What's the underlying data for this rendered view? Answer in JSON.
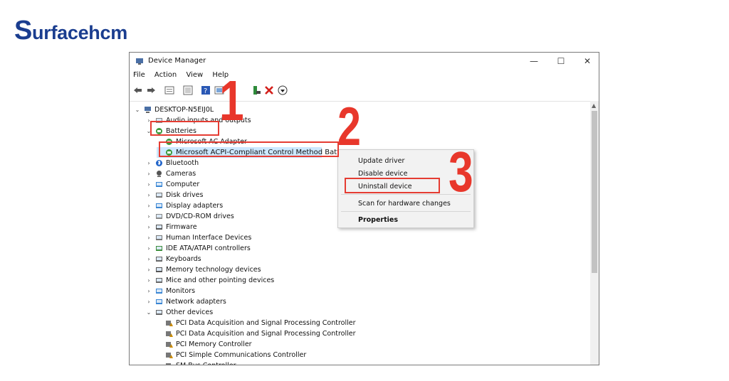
{
  "logo": {
    "first": "S",
    "rest": "urfacehcm"
  },
  "window": {
    "title": "Device Manager",
    "minimize": "—",
    "maximize": "☐",
    "close": "✕"
  },
  "menu": [
    "File",
    "Action",
    "View",
    "Help"
  ],
  "toolbar_icons": [
    "back-icon",
    "forward-icon",
    "properties-icon",
    "update-icon",
    "help-icon",
    "scan-icon",
    "add-driver-icon",
    "remove-icon",
    "disable-icon"
  ],
  "tree": {
    "root": "DESKTOP-N5EIJ0L",
    "items": [
      {
        "label": "Audio inputs and outputs",
        "icon": "speaker-icon"
      },
      {
        "label": "Batteries",
        "icon": "battery-icon",
        "expanded": true
      },
      {
        "label": "Microsoft AC Adapter",
        "icon": "battery-icon"
      },
      {
        "label": "Microsoft ACPI-Compliant Control Method Battery",
        "icon": "battery-icon"
      },
      {
        "label": "Bluetooth",
        "icon": "bluetooth-icon"
      },
      {
        "label": "Cameras",
        "icon": "camera-icon"
      },
      {
        "label": "Computer",
        "icon": "monitor-icon"
      },
      {
        "label": "Disk drives",
        "icon": "disk-icon"
      },
      {
        "label": "Display adapters",
        "icon": "display-icon"
      },
      {
        "label": "DVD/CD-ROM drives",
        "icon": "dvd-icon"
      },
      {
        "label": "Firmware",
        "icon": "chip-icon"
      },
      {
        "label": "Human Interface Devices",
        "icon": "hid-icon"
      },
      {
        "label": "IDE ATA/ATAPI controllers",
        "icon": "ide-icon"
      },
      {
        "label": "Keyboards",
        "icon": "keyboard-icon"
      },
      {
        "label": "Memory technology devices",
        "icon": "memory-icon"
      },
      {
        "label": "Mice and other pointing devices",
        "icon": "mouse-icon"
      },
      {
        "label": "Monitors",
        "icon": "monitor-icon"
      },
      {
        "label": "Network adapters",
        "icon": "network-icon"
      },
      {
        "label": "Other devices",
        "icon": "unknown-device-icon",
        "expanded": true
      },
      {
        "label": "PCI Data Acquisition and Signal Processing Controller",
        "icon": "warning-device-icon"
      },
      {
        "label": "PCI Data Acquisition and Signal Processing Controller",
        "icon": "warning-device-icon"
      },
      {
        "label": "PCI Memory Controller",
        "icon": "warning-device-icon"
      },
      {
        "label": "PCI Simple Communications Controller",
        "icon": "warning-device-icon"
      },
      {
        "label": "SM Bus Controller",
        "icon": "warning-device-icon"
      }
    ]
  },
  "context_menu": {
    "update_driver": "Update driver",
    "disable_device": "Disable device",
    "uninstall_device": "Uninstall device",
    "scan": "Scan for hardware changes",
    "properties": "Properties"
  },
  "callouts": [
    "1",
    "2",
    "3"
  ],
  "colors": {
    "brand": "#1a3d8f",
    "highlight": "#e53c32",
    "selection": "#cce8ff"
  }
}
